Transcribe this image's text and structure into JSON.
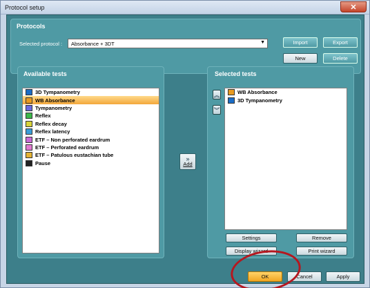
{
  "window": {
    "title": "Protocol setup",
    "close_glyph": "✕"
  },
  "protocols": {
    "title": "Protocols",
    "selected_label": "Selected protocol :",
    "selected_value": "Absorbance + 3DT",
    "buttons": {
      "import": "Import",
      "export": "Export",
      "new": "New",
      "delete": "Delete"
    }
  },
  "available": {
    "title": "Available tests",
    "items": [
      {
        "label": "3D Tympanometry",
        "icon": "tympanometry-3d-icon",
        "color": "#1a6dc7"
      },
      {
        "label": "WB Absorbance",
        "icon": "wb-absorbance-icon",
        "color": "#e89a20"
      },
      {
        "label": "Tympanometry",
        "icon": "tympanometry-icon",
        "color": "#6a6adf"
      },
      {
        "label": "Reflex",
        "icon": "reflex-icon",
        "color": "#3cb84a"
      },
      {
        "label": "Reflex decay",
        "icon": "reflex-decay-icon",
        "color": "#d8d33a"
      },
      {
        "label": "Reflex latency",
        "icon": "reflex-latency-icon",
        "color": "#3a9ed8"
      },
      {
        "label": "ETF – Non perforated eardrum",
        "icon": "etf-non-perforated-icon",
        "color": "#c96ad6"
      },
      {
        "label": "ETF – Perforated eardrum",
        "icon": "etf-perforated-icon",
        "color": "#e07ad0"
      },
      {
        "label": "ETF – Patulous eustachian tube",
        "icon": "etf-patulous-icon",
        "color": "#e3b334"
      },
      {
        "label": "Pause",
        "icon": "pause-icon",
        "color": "#222222"
      }
    ],
    "selected_index": 1
  },
  "add_button": {
    "label": "Add",
    "icon": "double-chevron-right-icon"
  },
  "selected": {
    "title": "Selected tests",
    "items": [
      {
        "label": "WB Absorbance",
        "icon": "wb-absorbance-icon",
        "color": "#e89a20"
      },
      {
        "label": "3D Tympanometry",
        "icon": "tympanometry-3d-icon",
        "color": "#1a6dc7"
      }
    ],
    "buttons": {
      "settings": "Settings",
      "remove": "Remove",
      "display_wizard": "Display wizard",
      "print_wizard": "Print wizard"
    }
  },
  "footer": {
    "ok": "OK",
    "cancel": "Cancel",
    "apply": "Apply"
  },
  "colors": {
    "background": "#3d7f8a",
    "panel": "#4f9aa4",
    "selection": "#f3a73a",
    "annotation_circle": "#b5171f"
  }
}
